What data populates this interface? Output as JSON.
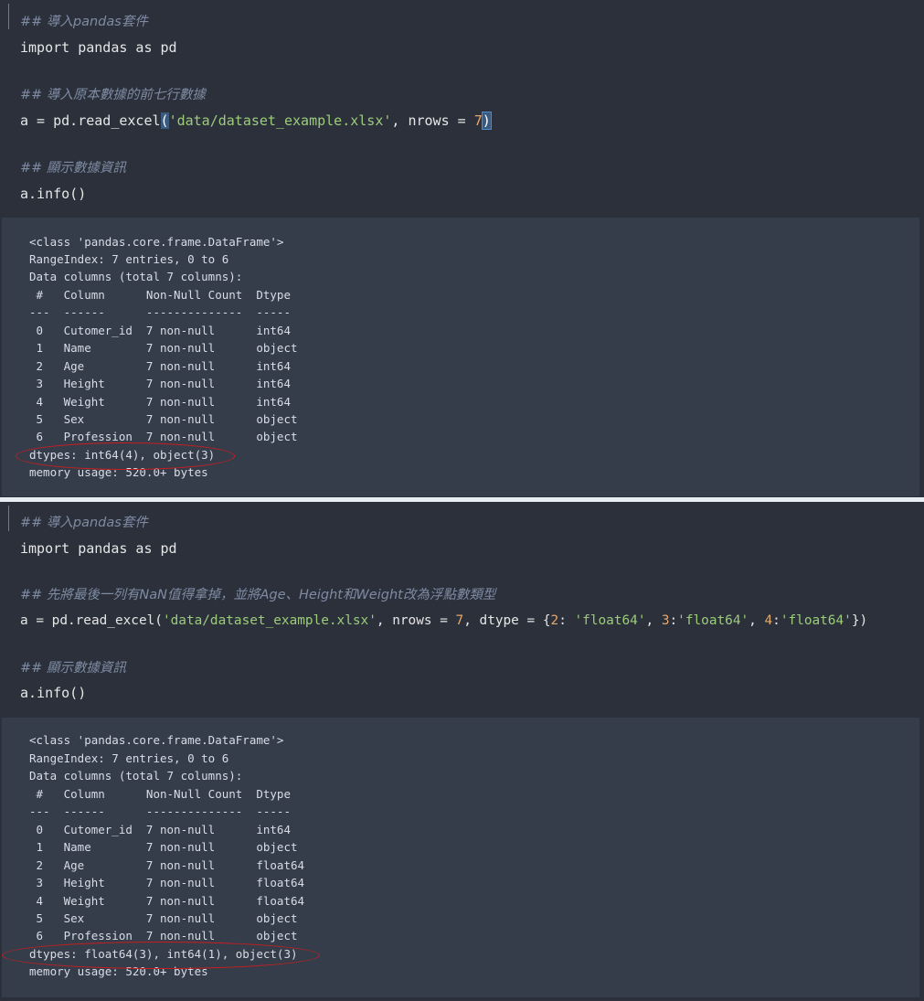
{
  "cells": [
    {
      "code": {
        "comment1": "## 導入pandas套件",
        "import_line": "import pandas as pd",
        "comment2": "## 導入原本數據的前七行數據",
        "read_prefix": "a = pd.read_excel",
        "read_open": "(",
        "read_path": "'data/dataset_example.xlsx'",
        "read_mid": ", nrows = ",
        "read_nrows": "7",
        "read_close": ")",
        "comment3": "## 顯示數據資訊",
        "info_line": "a.info()"
      },
      "output": [
        "<class 'pandas.core.frame.DataFrame'>",
        "RangeIndex: 7 entries, 0 to 6",
        "Data columns (total 7 columns):",
        " #   Column      Non-Null Count  Dtype ",
        "---  ------      --------------  ----- ",
        " 0   Cutomer_id  7 non-null      int64 ",
        " 1   Name        7 non-null      object",
        " 2   Age         7 non-null      int64 ",
        " 3   Height      7 non-null      int64 ",
        " 4   Weight      7 non-null      int64 ",
        " 5   Sex         7 non-null      object",
        " 6   Profession  7 non-null      object",
        "dtypes: int64(4), object(3)",
        "memory usage: 520.0+ bytes"
      ]
    },
    {
      "code": {
        "comment1": "## 導入pandas套件",
        "import_line": "import pandas as pd",
        "comment2": "## 先將最後一列有NaN值得拿掉，並將Age、Height和Weight改為浮點數類型",
        "read_prefix": "a = pd.read_excel(",
        "read_path": "'data/dataset_example.xlsx'",
        "read_mid": ", nrows = ",
        "read_nrows": "7",
        "read_dtype": ", dtype = {",
        "k2": "2",
        "sep1": ": ",
        "v2": "'float64'",
        "sep2": ", ",
        "k3": "3",
        "sep3": ":",
        "v3": "'float64'",
        "sep4": ", ",
        "k4": "4",
        "sep5": ":",
        "v4": "'float64'",
        "read_end": "})",
        "comment3": "## 顯示數據資訊",
        "info_line": "a.info()"
      },
      "output": [
        "<class 'pandas.core.frame.DataFrame'>",
        "RangeIndex: 7 entries, 0 to 6",
        "Data columns (total 7 columns):",
        " #   Column      Non-Null Count  Dtype  ",
        "---  ------      --------------  -----  ",
        " 0   Cutomer_id  7 non-null      int64  ",
        " 1   Name        7 non-null      object ",
        " 2   Age         7 non-null      float64",
        " 3   Height      7 non-null      float64",
        " 4   Weight      7 non-null      float64",
        " 5   Sex         7 non-null      object ",
        " 6   Profession  7 non-null      object ",
        "dtypes: float64(3), int64(1), object(3)",
        "memory usage: 520.0+ bytes"
      ]
    }
  ]
}
